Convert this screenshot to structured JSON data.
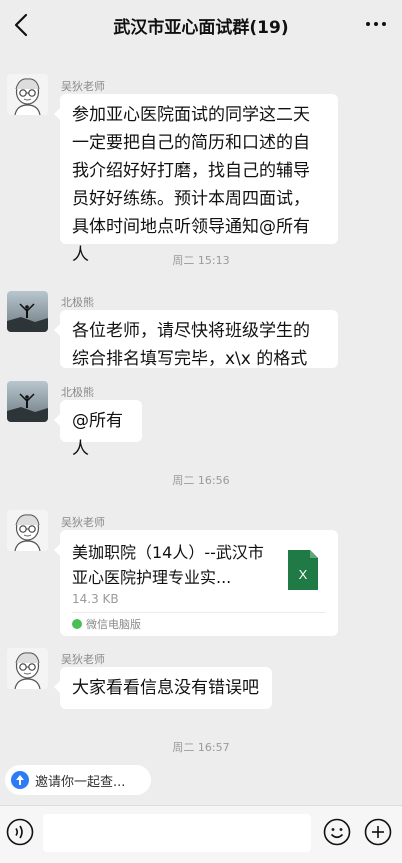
{
  "header": {
    "title": "武汉市亚心面试群(19)"
  },
  "messages": [
    {
      "sender": "吴狄老师",
      "text": "参加亚心医院面试的同学这二天一定要把自己的简历和口述的自我介绍好好打磨，找自己的辅导员好好练练。预计本周四面试，具体时间地点听领导通知@所有人"
    },
    {
      "sender": "北极熊",
      "text": "各位老师，请尽快将班级学生的综合排名填写完毕，x\\x 的格式"
    },
    {
      "sender": "北极熊",
      "text": "@所有人"
    },
    {
      "sender": "吴狄老师",
      "file_name": "美珈职院（14人）--武汉市亚心医院护理专业实...",
      "file_size": "14.3 KB",
      "file_source": "微信电脑版"
    },
    {
      "sender": "吴狄老师",
      "text": "大家看看信息没有错误吧"
    }
  ],
  "timestamps": [
    "周二 15:13",
    "周二 16:56",
    "周二 16:57"
  ],
  "invite": {
    "label": "邀请你一起查..."
  },
  "colors": {
    "background": "#ededed",
    "bubble": "#ffffff",
    "file_green": "#1f7a45",
    "invite_blue": "#2b7cf6"
  }
}
